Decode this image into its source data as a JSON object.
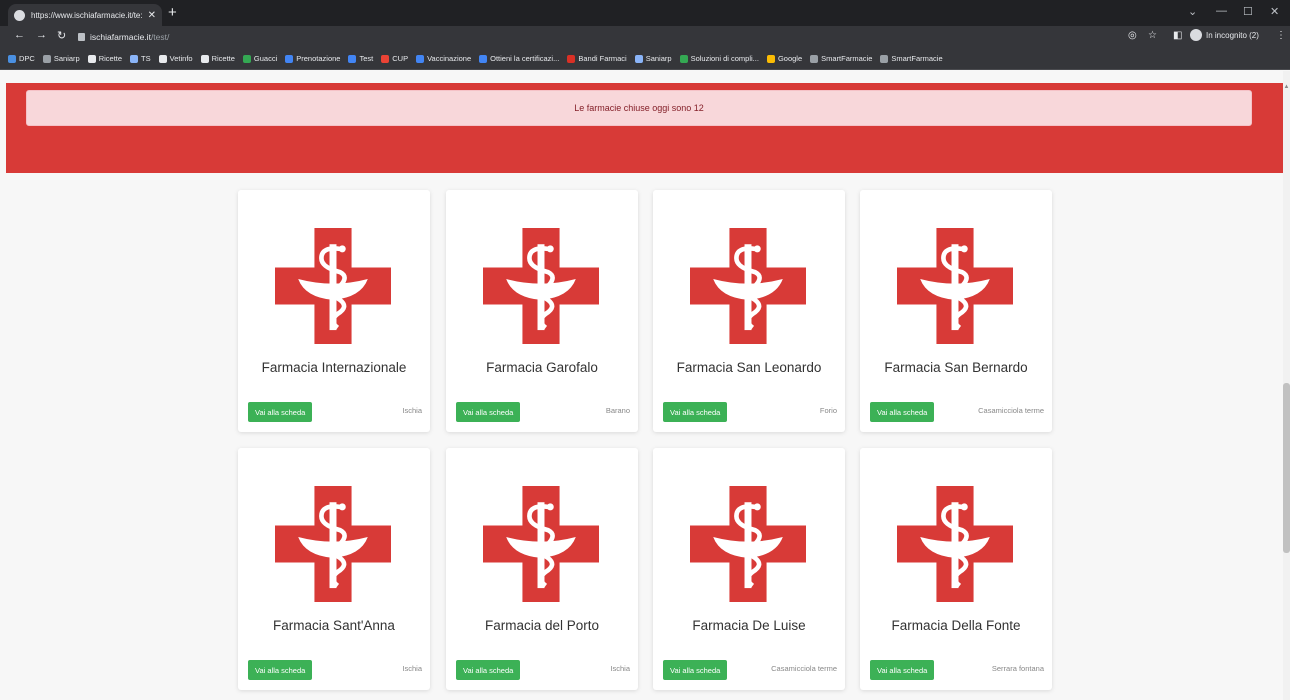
{
  "browser": {
    "tab_title": "https://www.ischiafarmacie.it/te:",
    "url_host": "ischiafarmacie.it",
    "url_path": "/test/",
    "incognito_label": "In incognito (2)",
    "bookmarks": [
      {
        "label": "DPC",
        "color": "#4a90e2"
      },
      {
        "label": "Saniarp",
        "color": "#9aa0a6"
      },
      {
        "label": "Ricette",
        "color": "#e8eaed"
      },
      {
        "label": "TS",
        "color": "#8ab4f8"
      },
      {
        "label": "Vetinfo",
        "color": "#e8eaed"
      },
      {
        "label": "Ricette",
        "color": "#e8eaed"
      },
      {
        "label": "Guacci",
        "color": "#34a853"
      },
      {
        "label": "Prenotazione",
        "color": "#4285f4"
      },
      {
        "label": "Test",
        "color": "#4285f4"
      },
      {
        "label": "CUP",
        "color": "#ea4335"
      },
      {
        "label": "Vaccinazione",
        "color": "#4285f4"
      },
      {
        "label": "Ottieni la certificazi...",
        "color": "#4285f4"
      },
      {
        "label": "Bandi Farmaci",
        "color": "#d93025"
      },
      {
        "label": "Saniarp",
        "color": "#8ab4f8"
      },
      {
        "label": "Soluzioni di compli...",
        "color": "#34a853"
      },
      {
        "label": "Google",
        "color": "#fbbc04"
      },
      {
        "label": "SmartFarmacie",
        "color": "#9aa0a6"
      },
      {
        "label": "SmartFarmacie",
        "color": "#9aa0a6"
      }
    ]
  },
  "alert": {
    "text": "Le farmacie chiuse oggi sono 12"
  },
  "cards": [
    {
      "name": "Farmacia Internazionale",
      "button": "Vai alla scheda",
      "town": "Ischia"
    },
    {
      "name": "Farmacia Garofalo",
      "button": "Vai alla scheda",
      "town": "Barano"
    },
    {
      "name": "Farmacia San Leonardo",
      "button": "Vai alla scheda",
      "town": "Forio"
    },
    {
      "name": "Farmacia San Bernardo",
      "button": "Vai alla scheda",
      "town": "Casamicciola terme"
    },
    {
      "name": "Farmacia Sant'Anna",
      "button": "Vai alla scheda",
      "town": "Ischia"
    },
    {
      "name": "Farmacia del Porto",
      "button": "Vai alla scheda",
      "town": "Ischia"
    },
    {
      "name": "Farmacia De Luise",
      "button": "Vai alla scheda",
      "town": "Casamicciola terme"
    },
    {
      "name": "Farmacia Della Fonte",
      "button": "Vai alla scheda",
      "town": "Serrara fontana"
    }
  ],
  "colors": {
    "brand_red": "#d83a37",
    "button_green": "#3cb156"
  }
}
